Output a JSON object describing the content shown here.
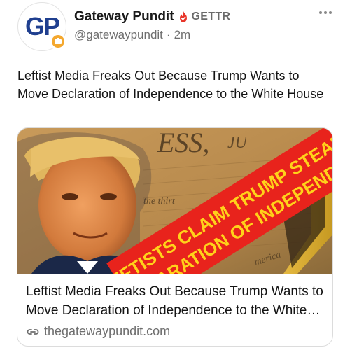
{
  "author": {
    "display_name": "Gateway Pundit",
    "platform": "GETTR",
    "handle": "@gatewaypundit",
    "time_ago": "2m",
    "separator": "·",
    "avatar_text_1": "G",
    "avatar_text_2": "P"
  },
  "post": {
    "text": "Leftist Media Freaks Out Because Trump Wants to Move Declaration of Independence to the White House"
  },
  "link_card": {
    "title": "Leftist Media Freaks Out Because Trump Wants to Move Declaration of Independence to the White House",
    "domain": "thegatewaypundit.com",
    "banner_line_1": "LEFTISTS CLAIM TRUMP STEALING",
    "banner_line_2": "DECLARATION OF INDEPENDENCE",
    "doc_text_1": "ESS,",
    "doc_text_2": "JU",
    "doc_text_3": "the thirt",
    "doc_text_4": "merica"
  },
  "icons": {
    "verified": "verified-flame-icon",
    "more": "more-horizontal-icon",
    "link": "link-icon"
  },
  "colors": {
    "verified": "#e8352a",
    "banner_red": "#e8231c",
    "banner_text": "#ffd21a",
    "gp_blue": "#1f3f8f",
    "badge_orange": "#f4a82f"
  }
}
